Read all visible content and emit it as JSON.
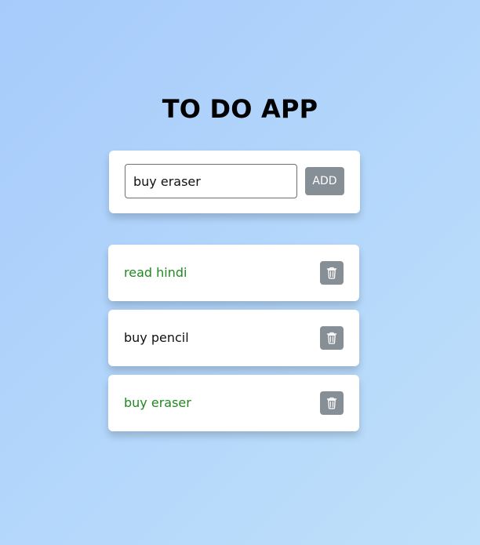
{
  "app": {
    "title": "TO DO APP"
  },
  "form": {
    "input_value": "buy eraser",
    "add_label": "ADD"
  },
  "todos": [
    {
      "text": "read hindi",
      "done": true,
      "delete_icon": "trash-icon"
    },
    {
      "text": "buy pencil",
      "done": false,
      "delete_icon": "trash-icon"
    },
    {
      "text": "buy eraser",
      "done": true,
      "delete_icon": "trash-icon"
    }
  ],
  "colors": {
    "done_text": "#1f8a1f",
    "pending_text": "#111111",
    "button_bg": "#868e96",
    "background_start": "#a7cbfb",
    "background_end": "#bfe0fa"
  }
}
